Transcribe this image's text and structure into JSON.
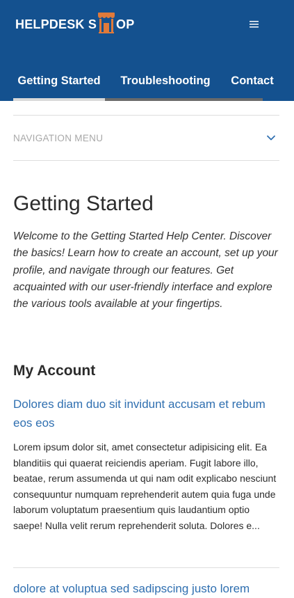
{
  "header": {
    "logo": {
      "text_left": "HELPDESK S",
      "text_right": "OP",
      "icon": "shop-icon"
    },
    "menu_icon": "hamburger-menu-icon",
    "tabs": [
      {
        "label": "Getting Started",
        "active": true
      },
      {
        "label": "Troubleshooting",
        "active": false
      },
      {
        "label": "Contact",
        "active": false
      }
    ]
  },
  "nav_menu": {
    "label": "NAVIGATION MENU",
    "icon": "chevron-down-icon"
  },
  "main": {
    "title": "Getting Started",
    "intro": "Welcome to the Getting Started Help Center. Discover the basics! Learn how to create an account, set up your profile, and navigate through our features. Get acquainted with our user-friendly interface and explore the various tools available at your fingertips.",
    "section": {
      "title": "My Account",
      "articles": [
        {
          "title": "Dolores diam duo sit invidunt accusam et rebum eos eos",
          "excerpt": "Lorem ipsum dolor sit, amet consectetur adipisicing elit. Ea blanditiis qui quaerat reiciendis aperiam. Fugit labore illo, beatae, rerum assumenda ut qui nam odit explicabo nesciunt consequuntur numquam reprehenderit autem quia fuga unde laborum voluptatum praesentium quis laudantium optio saepe! Nulla velit rerum reprehenderit soluta. Dolores e..."
        },
        {
          "title": "dolore at voluptua sed sadipscing justo lorem"
        }
      ]
    }
  },
  "colors": {
    "header_bg": "#14518f",
    "link": "#2f6fb0",
    "logo_accent": "#e07a3a"
  }
}
